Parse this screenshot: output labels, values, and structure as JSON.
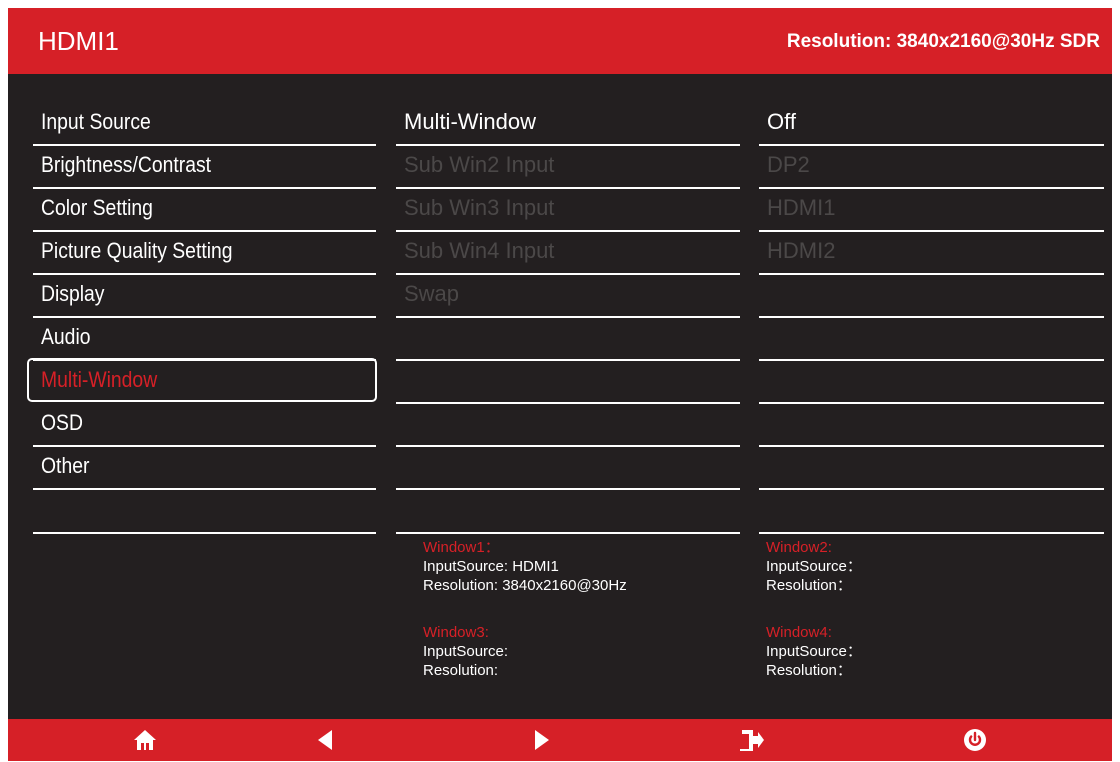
{
  "header": {
    "input": "HDMI1",
    "resolution": "Resolution: 3840x2160@30Hz SDR"
  },
  "menu": {
    "items": [
      {
        "label": "Input Source"
      },
      {
        "label": "Brightness/Contrast"
      },
      {
        "label": "Color Setting"
      },
      {
        "label": "Picture Quality Setting"
      },
      {
        "label": "Display"
      },
      {
        "label": "Audio"
      },
      {
        "label": "Multi-Window"
      },
      {
        "label": "OSD"
      },
      {
        "label": "Other"
      }
    ],
    "selected": "Multi-Window"
  },
  "submenu": {
    "items": [
      {
        "label": "Multi-Window",
        "value": "Off",
        "enabled": true
      },
      {
        "label": "Sub Win2 Input",
        "value": "DP2",
        "enabled": false
      },
      {
        "label": "Sub Win3 Input",
        "value": "HDMI1",
        "enabled": false
      },
      {
        "label": "Sub Win4 Input",
        "value": "HDMI2",
        "enabled": false
      },
      {
        "label": "Swap",
        "value": "",
        "enabled": false
      }
    ]
  },
  "windows": {
    "w1": {
      "title": "Window1：",
      "input": "InputSource: HDMI1",
      "resolution": "Resolution: 3840x2160@30Hz"
    },
    "w2": {
      "title": "Window2:",
      "input": "InputSource：",
      "resolution": "Resolution："
    },
    "w3": {
      "title": "Window3:",
      "input": "InputSource:",
      "resolution": "Resolution:"
    },
    "w4": {
      "title": "Window4:",
      "input": "InputSource：",
      "resolution": "Resolution："
    }
  },
  "footer": {
    "buttons": [
      "home-icon",
      "left-arrow-icon",
      "right-arrow-icon",
      "exit-icon",
      "power-icon"
    ]
  },
  "colors": {
    "accent": "#d62027",
    "background": "#231f20",
    "text": "#ffffff",
    "disabled": "#4b4848"
  }
}
